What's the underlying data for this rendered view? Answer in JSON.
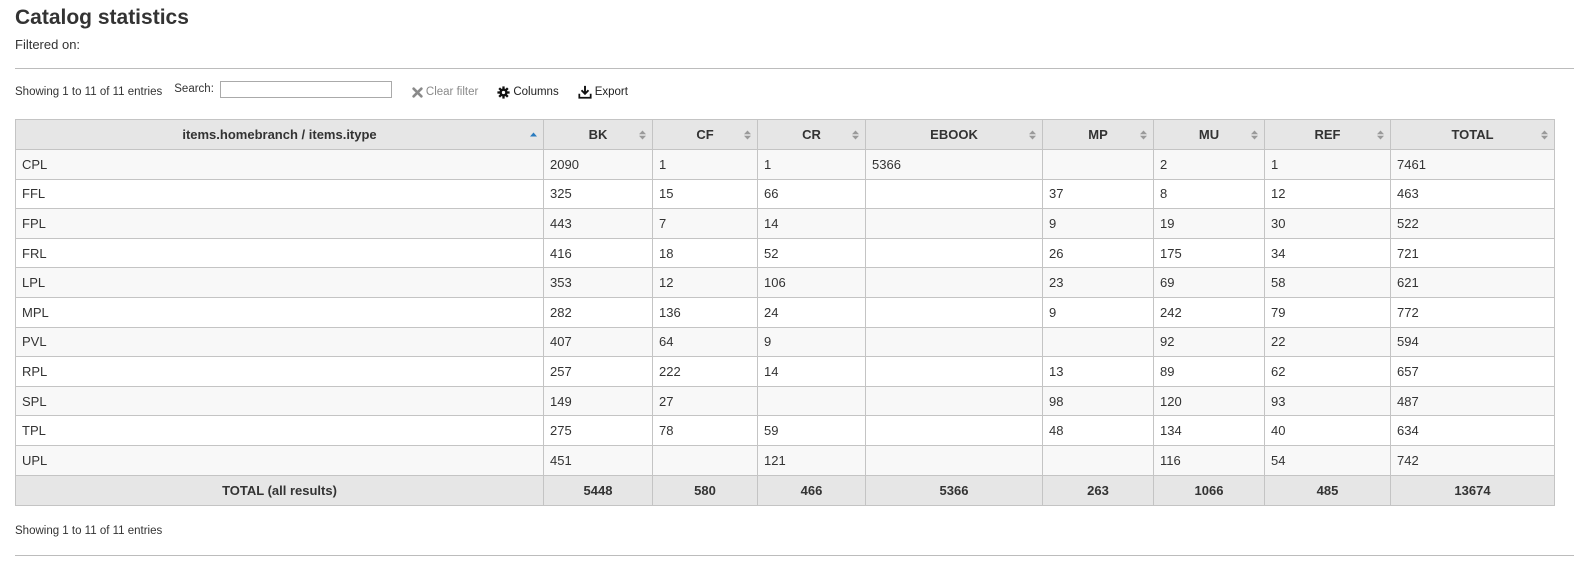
{
  "page": {
    "title": "Catalog statistics",
    "filtered_on": "Filtered on:"
  },
  "toolbar": {
    "info": "Showing 1 to 11 of 11 entries",
    "search_label": "Search:",
    "search_value": "",
    "clear_filter_label": "Clear filter",
    "columns_label": "Columns",
    "export_label": "Export"
  },
  "table": {
    "headers": [
      "items.homebranch / items.itype",
      "BK",
      "CF",
      "CR",
      "EBOOK",
      "MP",
      "MU",
      "REF",
      "TOTAL"
    ],
    "rows": [
      [
        "CPL",
        "2090",
        "1",
        "1",
        "5366",
        "",
        "2",
        "1",
        "7461"
      ],
      [
        "FFL",
        "325",
        "15",
        "66",
        "",
        "37",
        "8",
        "12",
        "463"
      ],
      [
        "FPL",
        "443",
        "7",
        "14",
        "",
        "9",
        "19",
        "30",
        "522"
      ],
      [
        "FRL",
        "416",
        "18",
        "52",
        "",
        "26",
        "175",
        "34",
        "721"
      ],
      [
        "LPL",
        "353",
        "12",
        "106",
        "",
        "23",
        "69",
        "58",
        "621"
      ],
      [
        "MPL",
        "282",
        "136",
        "24",
        "",
        "9",
        "242",
        "79",
        "772"
      ],
      [
        "PVL",
        "407",
        "64",
        "9",
        "",
        "",
        "92",
        "22",
        "594"
      ],
      [
        "RPL",
        "257",
        "222",
        "14",
        "",
        "13",
        "89",
        "62",
        "657"
      ],
      [
        "SPL",
        "149",
        "27",
        "",
        "",
        "98",
        "120",
        "93",
        "487"
      ],
      [
        "TPL",
        "275",
        "78",
        "59",
        "",
        "48",
        "134",
        "40",
        "634"
      ],
      [
        "UPL",
        "451",
        "",
        "121",
        "",
        "",
        "116",
        "54",
        "742"
      ]
    ],
    "footer": [
      "TOTAL (all results)",
      "5448",
      "580",
      "466",
      "5366",
      "263",
      "1066",
      "485",
      "13674"
    ]
  },
  "bottom_info": "Showing 1 to 11 of 11 entries",
  "colors": {
    "header_bg": "#e6e6e6",
    "row_alt_bg": "#f8f8f8",
    "border": "#c4c4c4",
    "sort_active": "#2a7bbf",
    "sort_inactive": "#9a9a9a"
  },
  "icons": {
    "clear_filter": "close-icon",
    "columns": "gear-icon",
    "export": "download-icon",
    "sort_asc": "sort-asc-icon",
    "sort_both": "sort-both-icon"
  }
}
